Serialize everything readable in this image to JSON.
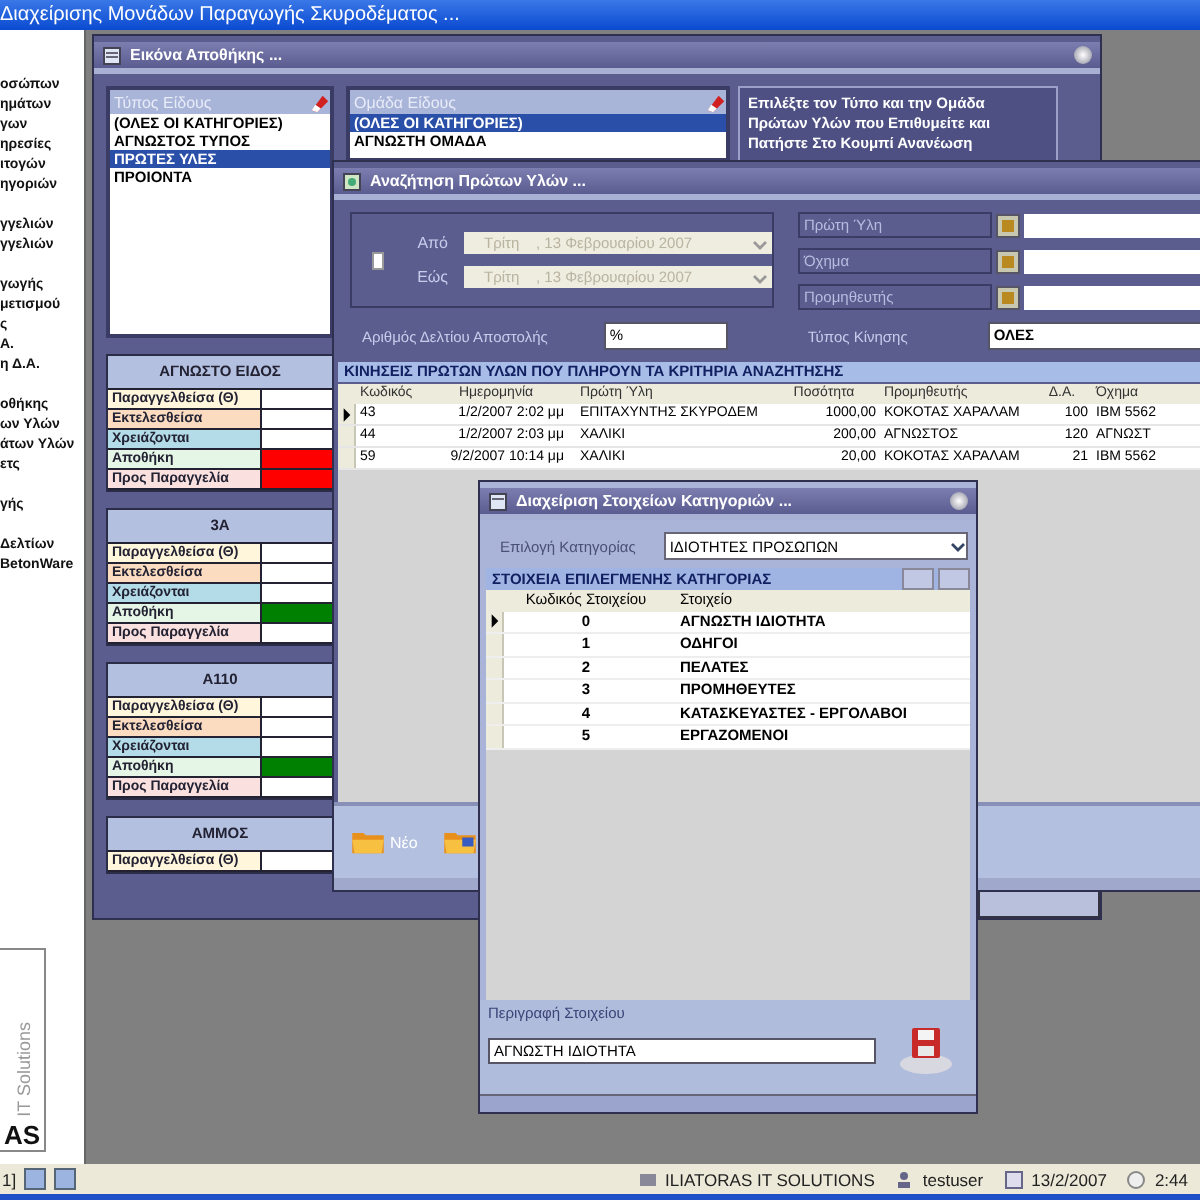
{
  "app_title": "Διαχείρισης Μονάδων Παραγωγής  Σκυροδέματος ...",
  "sidebar": {
    "groups": [
      [
        "οσώπων",
        "ημάτων",
        "γων",
        "ηρεσίες",
        "ιτογών",
        "ηγοριών"
      ],
      [
        "γγελιών",
        "γγελιών"
      ],
      [
        "γωγής",
        "μετισμού",
        "ς",
        "Α.",
        "η Δ.Α."
      ],
      [
        "οθήκης",
        "ων Υλών",
        "άτων Υλών",
        "ετς"
      ],
      [
        "γής"
      ],
      [
        "Δελτίων",
        "BetonWare"
      ]
    ],
    "logo": {
      "caption": "IT Solutions",
      "mark": "AS"
    }
  },
  "stock_window": {
    "title": "Εικόνα Αποθήκης ...",
    "type_list": {
      "header": "Τύπος Είδους",
      "items": [
        {
          "label": "(ΟΛΕΣ ΟΙ ΚΑΤΗΓΟΡΙΕΣ)",
          "selected": false
        },
        {
          "label": "ΑΓΝΩΣΤΟΣ ΤΥΠΟΣ",
          "selected": false
        },
        {
          "label": "ΠΡΩΤΕΣ ΥΛΕΣ",
          "selected": true
        },
        {
          "label": "ΠΡΟΙΟΝΤΑ",
          "selected": false
        }
      ]
    },
    "group_list": {
      "header": "Ομάδα Είδους",
      "items": [
        {
          "label": "(ΟΛΕΣ ΟΙ ΚΑΤΗΓΟΡΙΕΣ)",
          "selected": true
        },
        {
          "label": "ΑΓΝΩΣΤΗ ΟΜΑΔΑ",
          "selected": false
        }
      ]
    },
    "instructions": [
      "Επιλέξτε τον Τύπο και την Ομάδα",
      "Πρώτων Υλών που Επιθυμείτε και",
      "Πατήστε Στο Κουμπί Ανανέωση"
    ],
    "cards": [
      {
        "name": "ΑΓΝΩΣΤΟ ΕΙΔΟΣ",
        "rows": [
          {
            "label": "Παραγγελθείσα (Θ)",
            "kind": "ordered",
            "color": "#ffffff"
          },
          {
            "label": "Εκτελεσθείσα",
            "kind": "executed",
            "color": "#ffffff"
          },
          {
            "label": "Χρειάζονται",
            "kind": "needed",
            "color": "#ffffff"
          },
          {
            "label": "Αποθήκη",
            "kind": "stock",
            "color": "#ff0000"
          },
          {
            "label": "Προς Παραγγελία",
            "kind": "to_order",
            "color": "#ff0000"
          }
        ]
      },
      {
        "name": "3Α",
        "rows": [
          {
            "label": "Παραγγελθείσα (Θ)",
            "kind": "ordered",
            "color": "#ffffff"
          },
          {
            "label": "Εκτελεσθείσα",
            "kind": "executed",
            "color": "#ffffff"
          },
          {
            "label": "Χρειάζονται",
            "kind": "needed",
            "color": "#ffffff"
          },
          {
            "label": "Αποθήκη",
            "kind": "stock",
            "color": "#008000"
          },
          {
            "label": "Προς Παραγγελία",
            "kind": "to_order",
            "color": "#ffffff"
          }
        ]
      },
      {
        "name": "Α110",
        "rows": [
          {
            "label": "Παραγγελθείσα (Θ)",
            "kind": "ordered",
            "color": "#ffffff"
          },
          {
            "label": "Εκτελεσθείσα",
            "kind": "executed",
            "color": "#ffffff"
          },
          {
            "label": "Χρειάζονται",
            "kind": "needed",
            "color": "#ffffff"
          },
          {
            "label": "Αποθήκη",
            "kind": "stock",
            "color": "#008000"
          },
          {
            "label": "Προς Παραγγελία",
            "kind": "to_order",
            "color": "#ffffff"
          }
        ]
      },
      {
        "name": "ΑΜΜΟΣ",
        "rows": [
          {
            "label": "Παραγγελθείσα (Θ)",
            "kind": "ordered",
            "color": "#ffffff"
          }
        ]
      }
    ]
  },
  "search_window": {
    "title": "Αναζήτηση Πρώτων Υλών ...",
    "date_filter": {
      "checked": false,
      "from_label": "Από",
      "from_value": "Τρίτη    , 13 Φεβρουαρίου 2007",
      "to_label": "Εώς",
      "to_value": "Τρίτη    , 13 Φεβρουαρίου 2007",
      "disabled": true
    },
    "lookups": [
      "Πρώτη Ύλη",
      "Όχημα",
      "Προμηθευτής"
    ],
    "delivery_label": "Αριθμός Δελτίου Αποστολής",
    "delivery_value": "%",
    "movement_label": "Τύπος Κίνησης",
    "movement_value": "ΟΛΕΣ",
    "table": {
      "caption": "ΚΙΝΗΣΕΙΣ ΠΡΩΤΩΝ ΥΛΩΝ  ΠΟΥ ΠΛΗΡΟΥΝ ΤΑ ΚΡΙΤΗΡΙΑ ΑΝΑΖΗΤΗΣΗΣ",
      "columns": [
        "Κωδικός",
        "Ημερομηνία",
        "Πρώτη Ύλη",
        "Ποσότητα",
        "Προμηθευτής",
        "Δ.Α.",
        "Όχημα"
      ],
      "rows": [
        {
          "current": true,
          "cells": [
            "43",
            "1/2/2007 2:02 μμ",
            "ΕΠΙΤΑΧΥΝΤΗΣ  ΣΚΥΡΟΔΕΜ",
            "1000,00",
            "ΚΟΚΟΤΑΣ ΧΑΡΑΛΑΜ",
            "100",
            "IBM 5562"
          ]
        },
        {
          "current": false,
          "cells": [
            "44",
            "1/2/2007 2:03 μμ",
            "ΧΑΛΙΚΙ",
            "200,00",
            "ΑΓΝΩΣΤΟΣ",
            "120",
            "ΑΓΝΩΣΤ"
          ]
        },
        {
          "current": false,
          "cells": [
            "59",
            "9/2/2007 10:14 μμ",
            "ΧΑΛΙΚΙ",
            "20,00",
            "ΚΟΚΟΤΑΣ ΧΑΡΑΛΑΜ",
            "21",
            "IBM 5562"
          ]
        }
      ]
    },
    "toolbar": [
      {
        "label": "Νέο"
      }
    ]
  },
  "category_window": {
    "title": "Διαχείριση Στοιχείων Κατηγοριών ...",
    "category_label": "Επιλογή Κατηγορίας",
    "category_value": "ΙΔΙΟΤΗΤΕΣ ΠΡΟΣΩΠΩΝ",
    "table": {
      "caption": "ΣΤΟΙΧΕΙΑ  ΕΠΙΛΕΓΜΕΝΗΣ  ΚΑΤΗΓΟΡΙΑΣ",
      "columns": [
        "Κωδικός Στοιχείου",
        "Στοιχείο"
      ],
      "rows": [
        {
          "current": true,
          "code": "0",
          "name": "ΑΓΝΩΣΤΗ ΙΔΙΟΤΗΤΑ"
        },
        {
          "current": false,
          "code": "1",
          "name": "ΟΔΗΓΟΙ"
        },
        {
          "current": false,
          "code": "2",
          "name": "ΠΕΛΑΤΕΣ"
        },
        {
          "current": false,
          "code": "3",
          "name": "ΠΡΟΜΗΘΕΥΤΕΣ"
        },
        {
          "current": false,
          "code": "4",
          "name": "ΚΑΤΑΣΚΕΥΑΣΤΕΣ  - ΕΡΓΟΛΑΒΟΙ"
        },
        {
          "current": false,
          "code": "5",
          "name": "ΕΡΓΑΖΟΜΕΝΟΙ"
        }
      ]
    },
    "description_label": "Περιγραφή Στοιχείου",
    "description_value": "ΑΓΝΩΣΤΗ ΙΔΙΟΤΗΤΑ"
  },
  "taskbar": {
    "page": "1]",
    "company": "ILIATORAS IT SOLUTIONS",
    "user": "testuser",
    "date": "13/2/2007",
    "time": "2:44"
  }
}
